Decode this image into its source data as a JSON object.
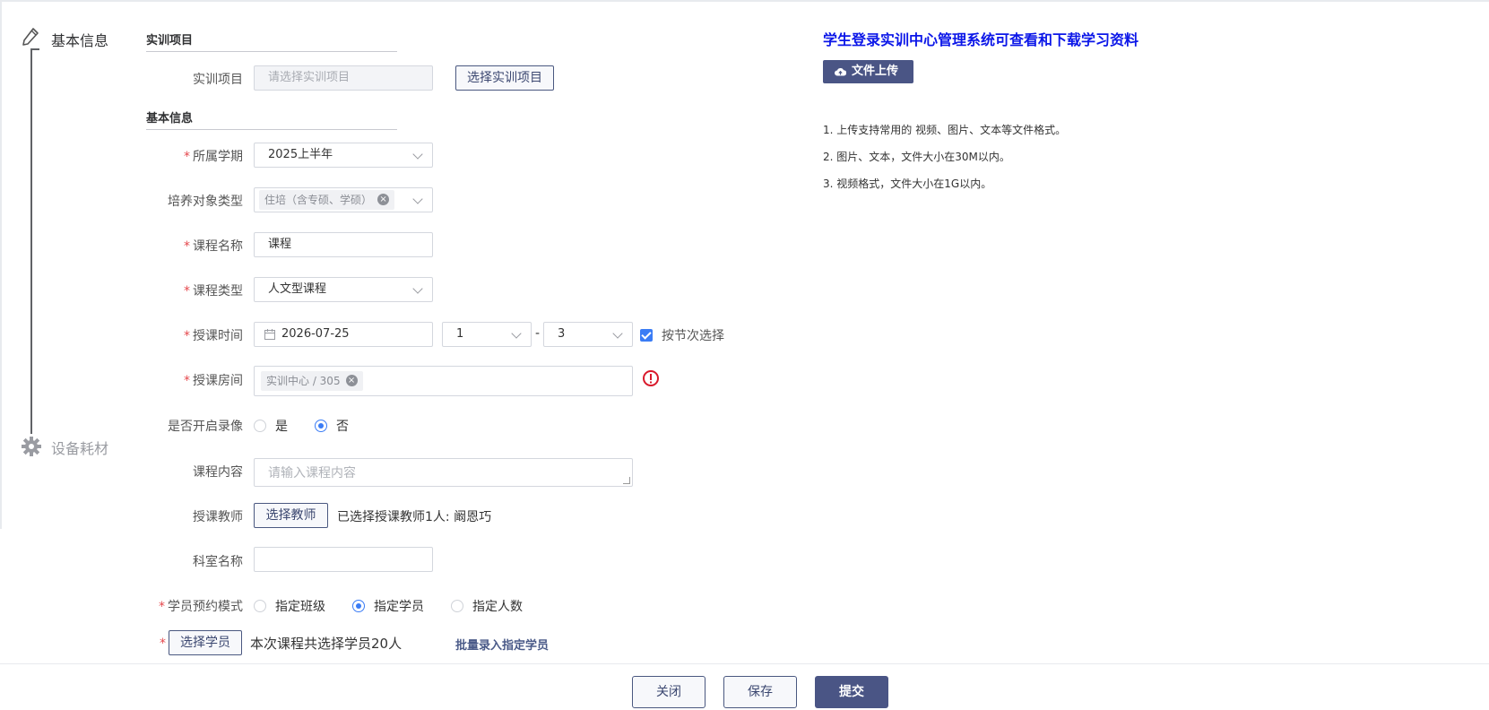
{
  "steps": [
    {
      "label": "基本信息",
      "active": true
    },
    {
      "label": "设备耗材",
      "active": false
    }
  ],
  "sections": {
    "project": "实训项目",
    "basic": "基本信息"
  },
  "form": {
    "project": {
      "label": "实训项目",
      "placeholder": "请选择实训项目",
      "button": "选择实训项目"
    },
    "semester": {
      "label": "所属学期",
      "value": "2025上半年"
    },
    "trainee_type": {
      "label": "培养对象类型",
      "tag": "住培（含专硕、学硕）"
    },
    "course_name": {
      "label": "课程名称",
      "value": "课程"
    },
    "course_type": {
      "label": "课程类型",
      "value": "人文型课程"
    },
    "teach_time": {
      "label": "授课时间",
      "date": "2026-07-25",
      "from": "1",
      "sep": "-",
      "to": "3",
      "by_section": "按节次选择"
    },
    "room": {
      "label": "授课房间",
      "tag": "实训中心 / 305"
    },
    "recording": {
      "label": "是否开启录像",
      "options": [
        "是",
        "否"
      ],
      "selected": "否"
    },
    "content": {
      "label": "课程内容",
      "placeholder": "请输入课程内容"
    },
    "teacher": {
      "label": "授课教师",
      "button": "选择教师",
      "selected_text": "已选择授课教师1人: 阚恩巧"
    },
    "department": {
      "label": "科室名称",
      "value": ""
    },
    "booking_mode": {
      "label": "学员预约模式",
      "options": [
        "指定班级",
        "指定学员",
        "指定人数"
      ],
      "selected": "指定学员"
    },
    "students": {
      "button": "选择学员",
      "summary": "本次课程共选择学员20人",
      "batch_link": "批量录入指定学员"
    }
  },
  "required_mark": "*",
  "right_panel": {
    "notice": "学生登录实训中心管理系统可查看和下载学习资料",
    "upload_button": "文件上传",
    "tips": [
      "1. 上传支持常用的 视频、图片、文本等文件格式。",
      "2. 图片、文本，文件大小在30M以内。",
      "3. 视频格式，文件大小在1G以内。"
    ]
  },
  "footer": {
    "close": "关闭",
    "save": "保存",
    "submit": "提交"
  },
  "colors": {
    "primary": "#4a5585",
    "accent_blue": "#3a7cf5",
    "notice_blue": "#0b16e8",
    "required_red": "#e5484d",
    "warning_red": "#d9192b"
  }
}
